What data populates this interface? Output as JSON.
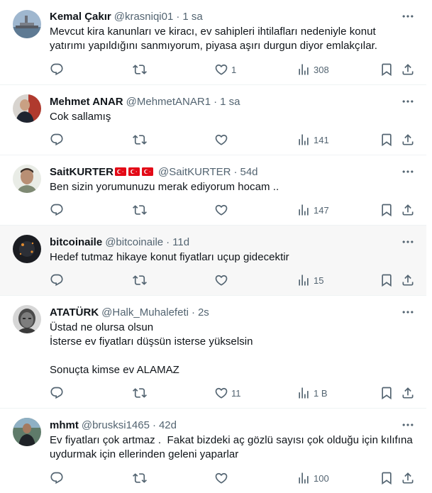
{
  "tweets": [
    {
      "name": "Kemal Çakır",
      "handle": "@krasniqi01",
      "time": "1 sa",
      "text": "Mevcut kira kanunları ve kiracı, ev sahipleri ihtilafları nedeniyle konut\nyatırımı yapıldığını sanmıyorum, piyasa aşırı durgun diyor emlakçılar.",
      "likes": "1",
      "views": "308"
    },
    {
      "name": "Mehmet ANAR",
      "handle": "@MehmetANAR1",
      "time": "1 sa",
      "text": "Cok sallamış",
      "likes": "",
      "views": "141"
    },
    {
      "name": "SaitKURTER",
      "handle": "@SaitKURTER",
      "time": "54d",
      "text": "Ben sizin yorumunuzu merak ediyorum hocam ..",
      "likes": "",
      "views": "147"
    },
    {
      "name": "bitcoinaile",
      "handle": "@bitcoinaile",
      "time": "11d",
      "text": "Hedef tutmaz hikaye konut fiyatları uçup gidecektir",
      "likes": "",
      "views": "15"
    },
    {
      "name": "ATATÜRK",
      "handle": "@Halk_Muhalefeti",
      "time": "2s",
      "text": "Üstad ne olursa olsun\nİsterse ev fiyatları düşsün isterse yükselsin\n\nSonuçta kimse ev ALAMAZ",
      "likes": "11",
      "views": "1 B"
    },
    {
      "name": "mhmt",
      "handle": "@brusksi1465",
      "time": "42d",
      "text": "Ev fiyatları çok artmaz .  Fakat bizdeki aç gözlü sayısı çok olduğu için kılıfına\nuydurmak için ellerinden geleni yaparlar",
      "likes": "",
      "views": "100"
    }
  ],
  "colors": {
    "text": "#0f1419",
    "secondary": "#536471",
    "divider": "#eff3f4",
    "highlight_bg": "#f7f7f7",
    "flag_red": "#e30a17"
  },
  "icons": [
    "more-icon",
    "reply-icon",
    "retweet-icon",
    "like-icon",
    "views-icon",
    "bookmark-icon",
    "share-icon",
    "turkish-flag-icon"
  ]
}
